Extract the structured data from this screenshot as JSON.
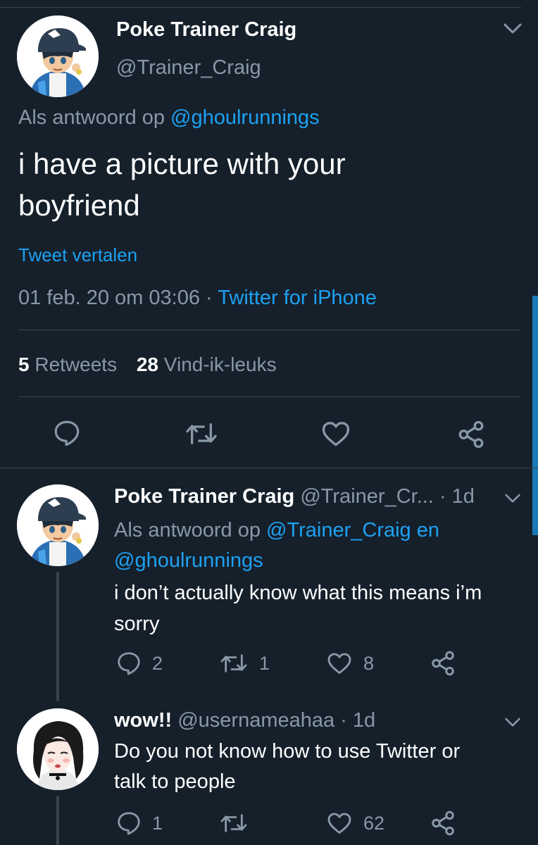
{
  "main_tweet": {
    "display_name": "Poke Trainer Craig",
    "handle": "@Trainer_Craig",
    "reply_prefix": "Als antwoord op",
    "reply_to": "@ghoulrunnings",
    "text_line1": "i have a picture with your",
    "text_line2": "boyfriend",
    "translate": "Tweet vertalen",
    "timestamp": "01 feb. 20 om 03:06",
    "dot": "·",
    "source": "Twitter for iPhone",
    "retweets_count": "5",
    "retweets_label": "Retweets",
    "likes_count": "28",
    "likes_label": "Vind-ik-leuks"
  },
  "replies": [
    {
      "display_name": "Poke Trainer Craig",
      "handle": "@Trainer_Cr...",
      "time": "· 1d",
      "reply_prefix": "Als antwoord op",
      "reply_to_line1": "@Trainer_Craig en",
      "reply_to_line2": "@ghoulrunnings",
      "text_line1": "i don’t actually know what this means i’m",
      "text_line2": "sorry",
      "replies": "2",
      "retweets": "1",
      "likes": "8"
    },
    {
      "display_name": "wow!!",
      "handle": "@usernameahaa",
      "time": "· 1d",
      "text_line1": "Do you not know how to use Twitter or",
      "text_line2": "talk to people",
      "replies": "1",
      "retweets": "",
      "likes": "62"
    }
  ],
  "colors": {
    "background": "#15202b",
    "accent": "#1da1f2",
    "secondary_text": "#8899a6",
    "divider": "#38444d"
  },
  "icons": [
    "chevron-down-icon",
    "reply-icon",
    "retweet-icon",
    "like-icon",
    "share-icon"
  ]
}
